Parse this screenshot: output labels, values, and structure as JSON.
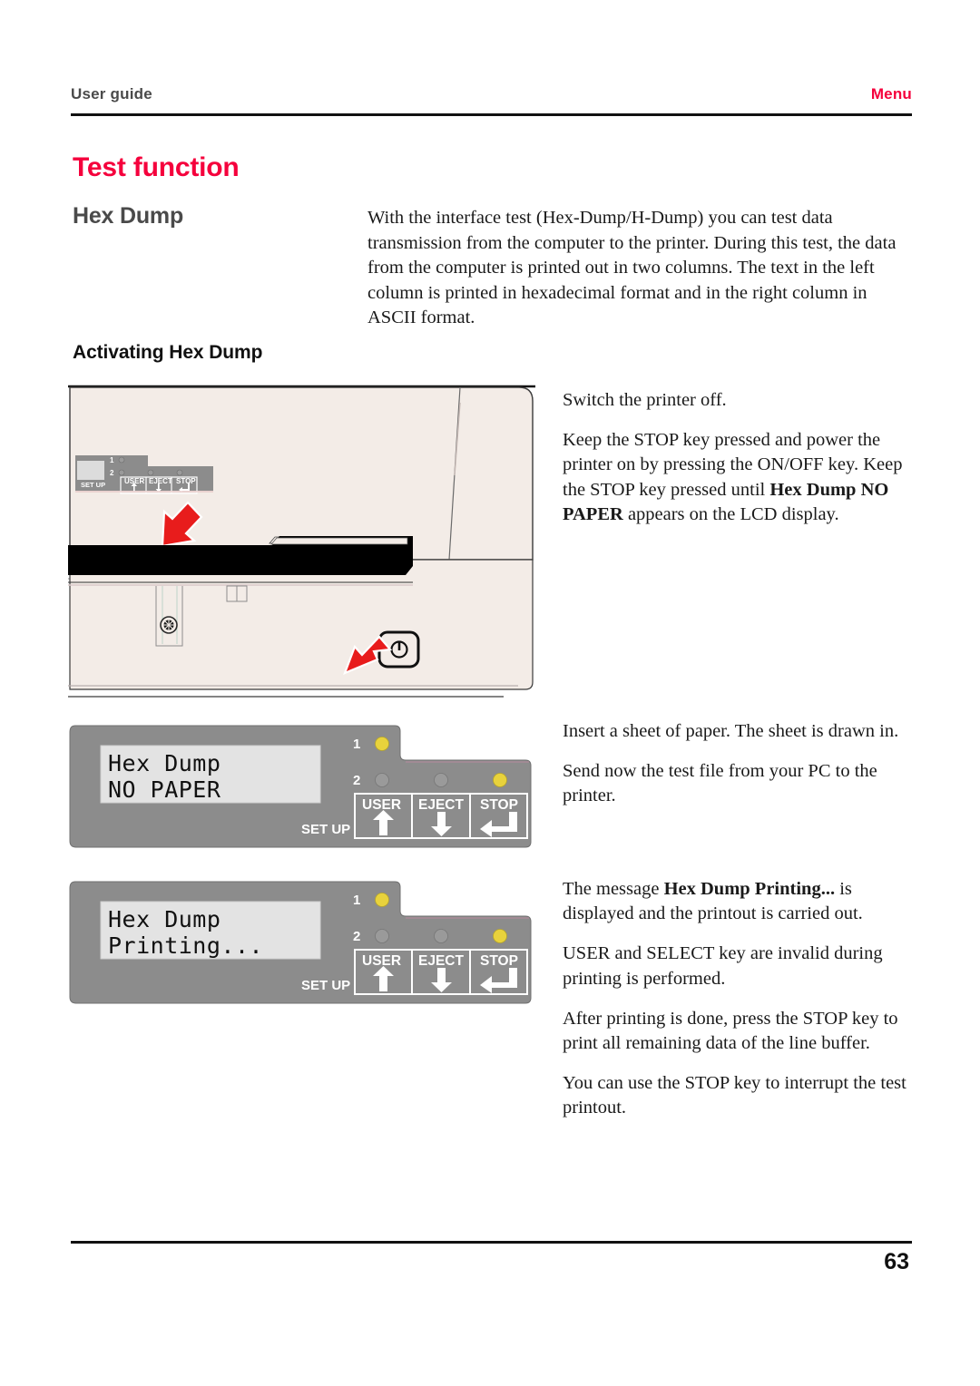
{
  "colors": {
    "accent_red": "#f5003c",
    "heading_gray": "#4a4a4a",
    "panel_gray": "#8c8c8c",
    "lcd_bg": "#e3e3e3",
    "printer_body": "#f3ece7",
    "led_on": "#e8d23c",
    "led_off": "#9a9a9a",
    "rule_black": "#111111"
  },
  "running_head": {
    "left_label": "User guide",
    "right_label": "Menu"
  },
  "titles": {
    "chapter": "Test function",
    "section": "Hex Dump",
    "subsection": "Activating Hex Dump"
  },
  "intro": {
    "paragraph": "With the interface test (Hex-Dump/H-Dump) you can test data transmission from the computer to the printer. During this test, the data from the computer is printed out in two columns. The text in the left column is printed in hexadecimal format and in the right column in ASCII format."
  },
  "steps": {
    "group_a": {
      "p1": "Switch the printer off.",
      "p2_part1": "Keep the STOP key pressed and power the printer on by pressing the ON/OFF key. Keep the STOP key pressed until ",
      "p2_bold1": "Hex Dump NO PAPER",
      "p2_part2": " appears on the LCD display."
    },
    "group_b": {
      "p1": "Insert a sheet of paper. The sheet is drawn in.",
      "p2": "Send now the test file from your PC to the printer."
    },
    "group_c": {
      "p1_part1": "The message ",
      "p1_bold": "Hex Dump Printing...",
      "p1_part2": " is displayed and the printout is carried out.",
      "p2": "USER and SELECT key are invalid during printing is performed.",
      "p3": "After printing is done, press the STOP key to print all remaining data of the line buffer.",
      "p4": "You can use the STOP key to interrupt the test printout."
    }
  },
  "printer_figure": {
    "caption_alt": "printer front view with operator panel and ON/OFF key",
    "panel": {
      "led_rows": [
        "1",
        "2"
      ],
      "keys": [
        "USER",
        "EJECT",
        "STOP"
      ],
      "setup_label": "SET UP",
      "key_icons": [
        "up-arrow-icon",
        "down-arrow-icon",
        "enter-arrow-icon"
      ]
    },
    "power_button_icon": "power-symbol-icon",
    "arrow_targets": [
      "stop-key",
      "power-button"
    ]
  },
  "panels": [
    {
      "id": "panel-no-paper",
      "lcd_line1": "Hex Dump",
      "lcd_line2": "NO PAPER",
      "led_rows": [
        "1",
        "2"
      ],
      "leds": [
        {
          "name": "led-1",
          "state": "on"
        },
        {
          "name": "led-2",
          "state": "off"
        },
        {
          "name": "led-eject",
          "state": "off"
        },
        {
          "name": "led-stop",
          "state": "on"
        }
      ],
      "setup_label": "SET UP",
      "keys": [
        "USER",
        "EJECT",
        "STOP"
      ]
    },
    {
      "id": "panel-printing",
      "lcd_line1": "Hex Dump",
      "lcd_line2": "Printing...",
      "led_rows": [
        "1",
        "2"
      ],
      "leds": [
        {
          "name": "led-1",
          "state": "on"
        },
        {
          "name": "led-2",
          "state": "off"
        },
        {
          "name": "led-eject",
          "state": "off"
        },
        {
          "name": "led-stop",
          "state": "on"
        }
      ],
      "setup_label": "SET UP",
      "keys": [
        "USER",
        "EJECT",
        "STOP"
      ]
    }
  ],
  "footer": {
    "page_number": "63"
  }
}
